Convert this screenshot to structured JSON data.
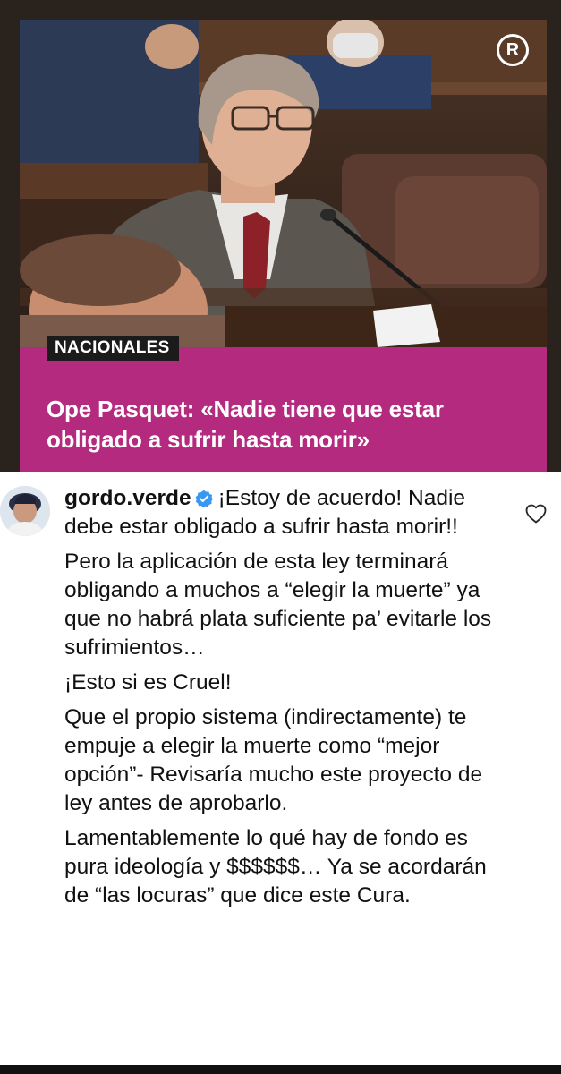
{
  "post": {
    "logo_letter": "R",
    "section": "NACIONALES",
    "headline": "Ope Pasquet: «Nadie tiene que estar obligado a sufrir hasta morir»",
    "banner_color": "#b42a7e"
  },
  "comment": {
    "username": "gordo.verde",
    "verified": true,
    "paragraphs": [
      "¡Estoy de acuerdo! Nadie debe estar obligado a sufrir hasta morir!!",
      "Pero la aplicación de esta ley terminará obligando a muchos a “elegir la muerte” ya que no habrá plata suficiente pa’ evitarle los sufrimientos…",
      " ¡Esto si es Cruel!",
      "Que el propio sistema (indirectamente) te empuje a elegir la muerte como “mejor opción”- Revisaría mucho este proyecto de ley antes de aprobarlo.",
      "Lamentablemente lo qué hay de fondo es pura ideología y $$$$$$… Ya se acordarán de “las locuras” que dice este Cura."
    ],
    "icons": {
      "like": "heart-icon",
      "verified": "verified-badge-icon"
    },
    "verified_color": "#3897f0"
  }
}
